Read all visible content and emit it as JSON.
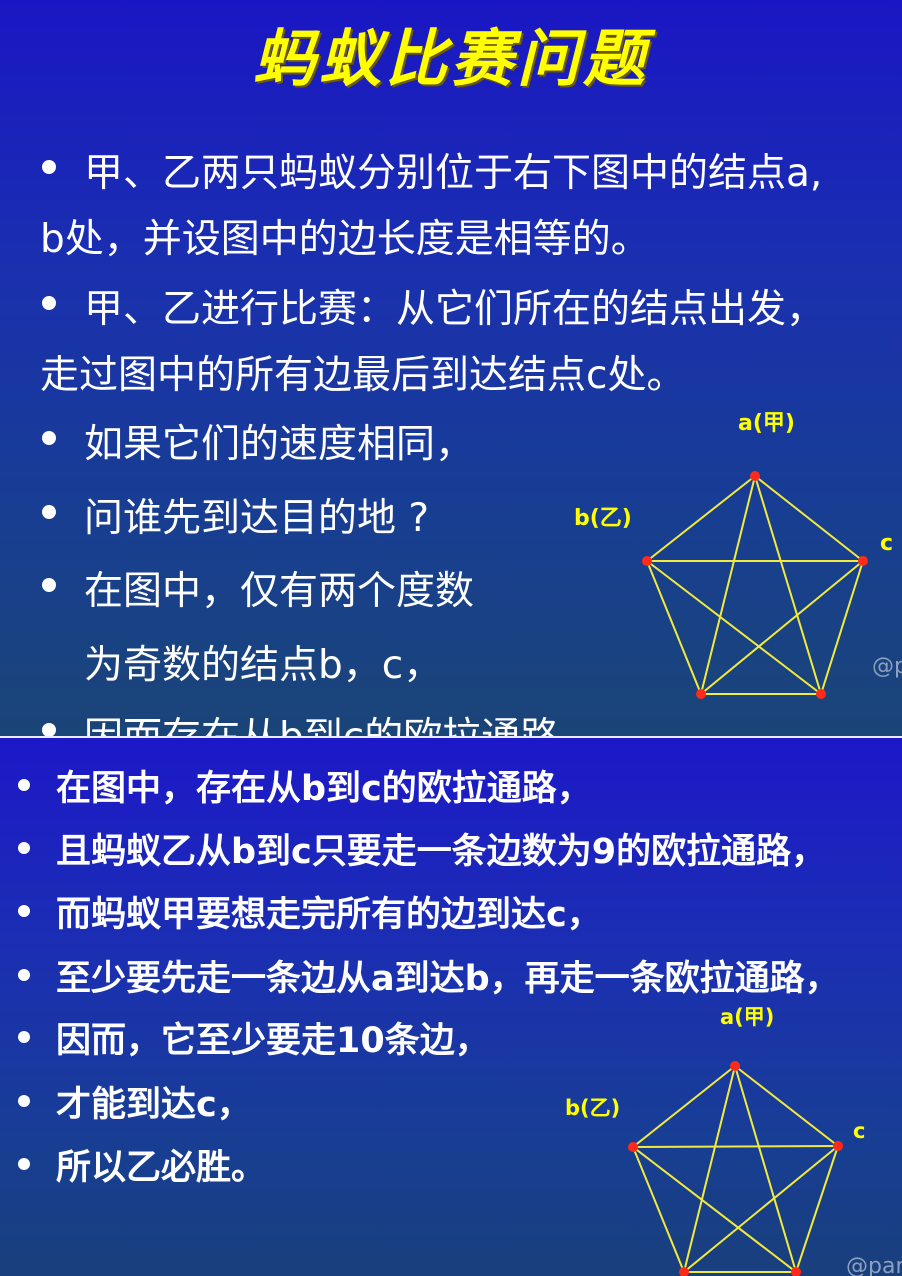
{
  "title": "蚂蚁比赛问题",
  "top_lines": [
    "甲、乙两只蚂蚁分别位于右下图中的结点a,",
    "b处，并设图中的边长度是相等的。",
    "甲、乙进行比赛：从它们所在的结点出发，",
    "走过图中的所有边最后到达结点c处。",
    "如果它们的速度相同，",
    "问谁先到达目的地 ?",
    "在图中，仅有两个度数",
    "为奇数的结点b，c，",
    "因而存在从b到c的欧拉通路。"
  ],
  "bottom_lines": [
    "在图中，存在从b到c的欧拉通路，",
    "且蚂蚁乙从b到c只要走一条边数为9的欧拉通路，",
    "而蚂蚁甲要想走完所有的边到达c，",
    "至少要先走一条边从a到达b，再走一条欧拉通路，",
    "因而，它至少要走10条边，",
    "才能到达c，",
    "所以乙必胜。"
  ],
  "graph_labels": {
    "a": "a(甲)",
    "b": "b(乙)",
    "c": "c"
  },
  "watermark": "@p",
  "watermark2": "@pan",
  "colors": {
    "title": "#ffff00",
    "edge": "#f2ea3c",
    "node": "#ff2a1a",
    "label": "#ffff00",
    "text": "#ffffff"
  }
}
